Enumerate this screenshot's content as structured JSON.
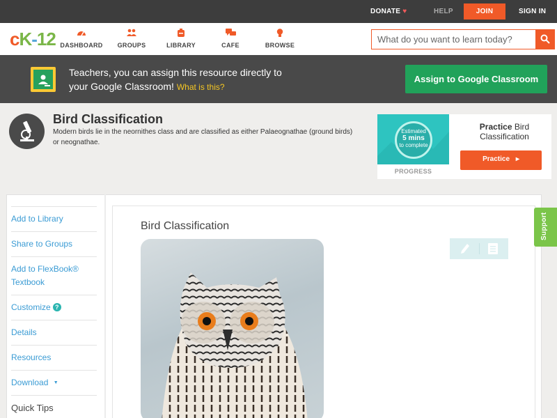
{
  "topbar": {
    "donate_label": "DONATE",
    "help_label": "HELP",
    "join_label": "JOIN",
    "signin_label": "SIGN IN"
  },
  "logo": {
    "c": "c",
    "k": "K",
    "dash": "-",
    "num": "12"
  },
  "nav": {
    "items": [
      {
        "label": "DASHBOARD",
        "icon": "dashboard-icon"
      },
      {
        "label": "GROUPS",
        "icon": "groups-icon"
      },
      {
        "label": "LIBRARY",
        "icon": "library-icon"
      },
      {
        "label": "CAFE",
        "icon": "cafe-icon"
      },
      {
        "label": "BROWSE",
        "icon": "browse-icon"
      }
    ],
    "search_placeholder": "What do you want to learn today?"
  },
  "classroom_banner": {
    "line1": "Teachers, you can assign this resource directly to",
    "line2": "your Google Classroom!",
    "link": "What is this?",
    "button_label": "Assign to Google Classroom"
  },
  "concept": {
    "title": "Bird Classification",
    "description": "Modern birds lie in the neornithes class and are classified as either Palaeognathae (ground birds) or neognathae.",
    "icon": "microscope-icon"
  },
  "practice": {
    "estimated": "Estimated",
    "mins": "5 mins",
    "complete": "to complete",
    "progress_label": "PROGRESS",
    "title_bold": "Practice",
    "title_rest": "Bird Classification",
    "button_label": "Practice"
  },
  "sidebar": {
    "items": [
      {
        "label": "Add to Library"
      },
      {
        "label": "Share to Groups"
      },
      {
        "label": "Add to FlexBook® Textbook"
      },
      {
        "label": "Customize",
        "help": "?"
      },
      {
        "label": "Details"
      },
      {
        "label": "Resources"
      },
      {
        "label": "Download",
        "caret": "▼"
      },
      {
        "label": "Quick Tips"
      }
    ]
  },
  "main": {
    "title": "Bird Classification",
    "image_alt": "owl photo"
  },
  "support_label": "Support",
  "colors": {
    "accent": "#f05a28",
    "link": "#3a9bd4",
    "google_green": "#21a25a",
    "support_green": "#7bc549",
    "topbar": "#3d3d3d"
  }
}
